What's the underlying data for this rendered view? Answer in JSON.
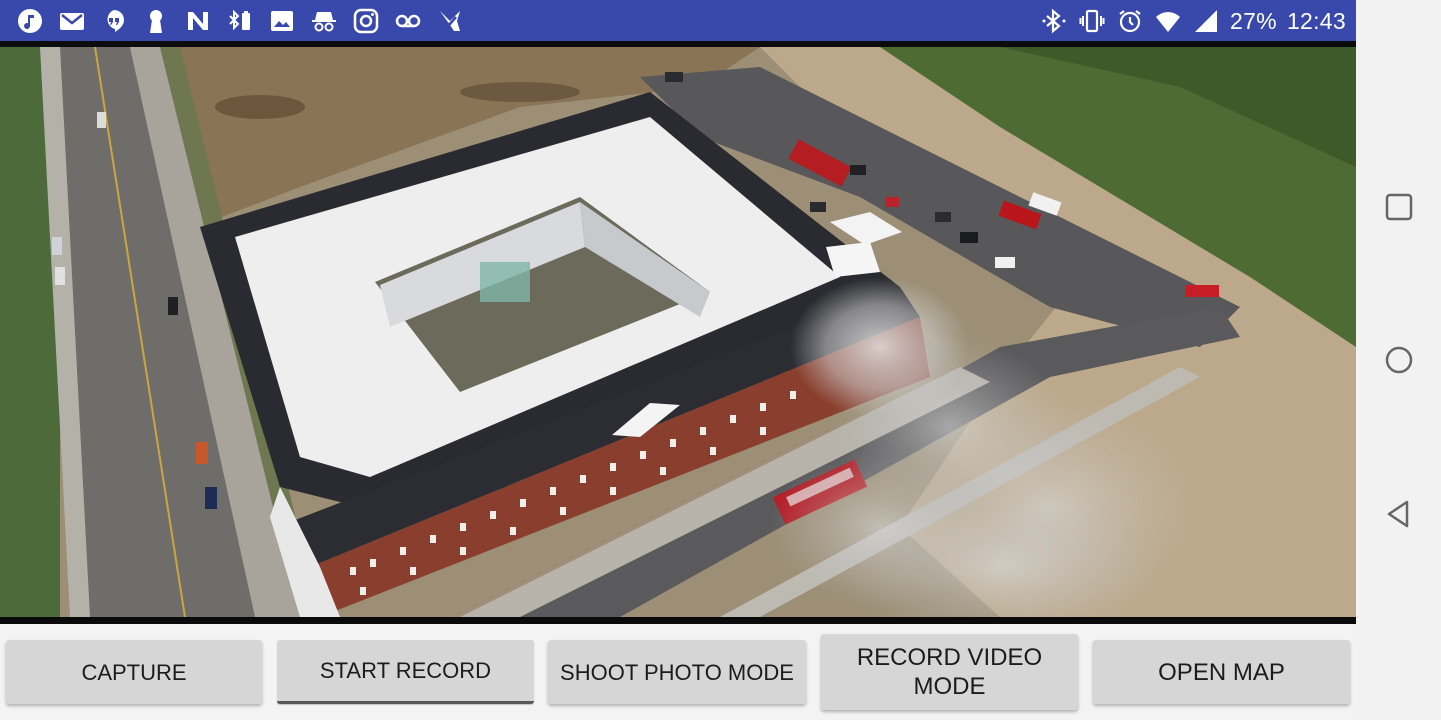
{
  "status_bar": {
    "left_icons": [
      "music-note-icon",
      "gmail-icon",
      "hangouts-icon",
      "keyhole-icon",
      "vpn-n-icon",
      "bluetooth-battery-icon",
      "image-icon",
      "incognito-icon",
      "instagram-icon",
      "voicemail-icon",
      "checkmark-app-icon"
    ],
    "right_icons": [
      "bluetooth-icon",
      "vibrate-icon",
      "alarm-icon",
      "wifi-icon",
      "cell-signal-icon"
    ],
    "battery": "27%",
    "time": "12:43",
    "background_color": "#3949ab"
  },
  "video_feed": {
    "description_icon": "aerial-camera-view"
  },
  "buttons": {
    "capture": "CAPTURE",
    "start_record": "START RECORD",
    "shoot_photo_mode": "SHOOT PHOTO MODE",
    "record_video_mode_line1": "RECORD VIDEO",
    "record_video_mode_line2": "MODE",
    "open_map": "OPEN MAP"
  },
  "nav_bar": {
    "items": [
      "recents-square-icon",
      "home-circle-icon",
      "back-triangle-icon"
    ]
  }
}
